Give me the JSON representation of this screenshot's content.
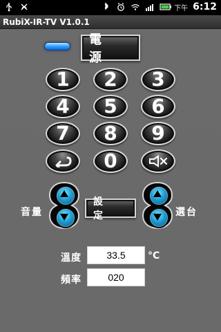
{
  "status_bar": {
    "time": "6:12",
    "ampm": "下午",
    "icons": [
      "usb-icon",
      "debug-icon",
      "bluetooth-icon",
      "alarm-icon",
      "wifi-icon",
      "signal-icon",
      "battery-icon"
    ]
  },
  "app": {
    "title": "RubiX-IR-TV  V1.0.1"
  },
  "controls": {
    "power_label": "電 源",
    "setting_label": "設 定"
  },
  "keypad": {
    "digits": [
      "1",
      "2",
      "3",
      "4",
      "5",
      "6",
      "7",
      "8",
      "9",
      "0"
    ]
  },
  "rockers": {
    "volume_label": "音量",
    "channel_label": "選台"
  },
  "fields": {
    "temperature_label": "溫度",
    "temperature_value": "33.5",
    "temperature_unit": "°C",
    "frequency_label": "頻率",
    "frequency_value": "020"
  },
  "colors": {
    "background": "#6b6b6b",
    "led_blue": "#2b8cff",
    "rocker_cyan": "#1c9bd1"
  }
}
